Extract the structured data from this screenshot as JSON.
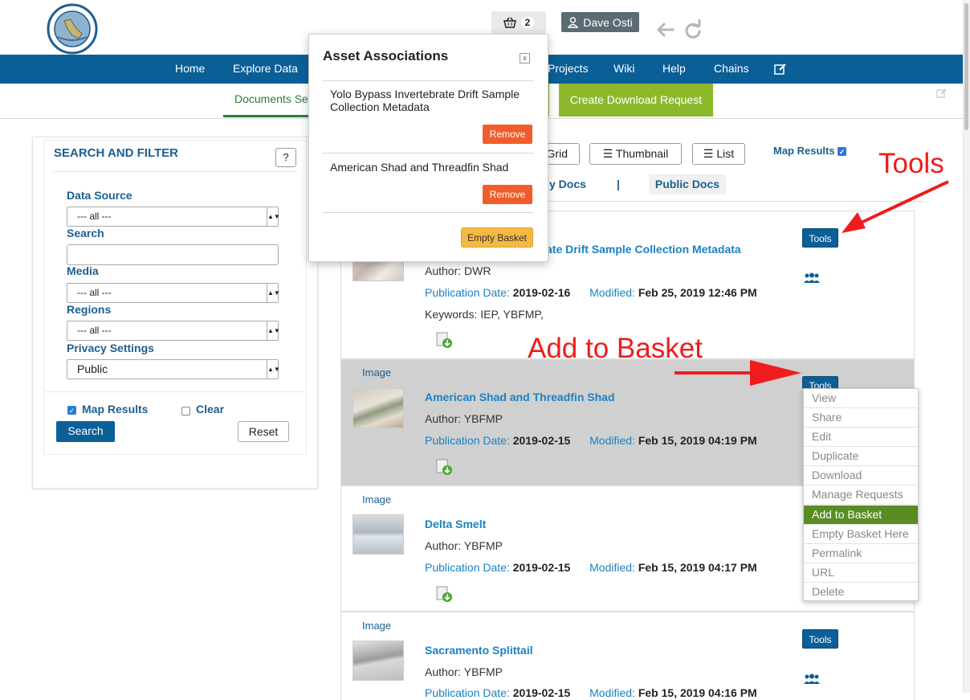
{
  "header": {
    "seal_alt": "Department of Water Resources - State of California",
    "basket_count": "2",
    "user_name": "Dave Osti"
  },
  "nav": {
    "items": [
      "Home",
      "Explore Data",
      "Projects",
      "Wiki",
      "Help",
      "Chains"
    ]
  },
  "subnav": {
    "documents_tab": "Documents Search",
    "create_download": "Create Download Request"
  },
  "sidebar": {
    "title": "SEARCH AND FILTER",
    "help": "?",
    "data_source_label": "Data Source",
    "data_source_value": "--- all ---",
    "search_label": "Search",
    "search_value": "",
    "media_label": "Media",
    "media_value": "--- all ---",
    "regions_label": "Regions",
    "regions_value": "--- all ---",
    "privacy_label": "Privacy Settings",
    "privacy_value": "Public",
    "map_results": "Map Results",
    "clear": "Clear",
    "search_button": "Search",
    "reset_button": "Reset"
  },
  "views": {
    "grid": "Grid",
    "thumbnail": "Thumbnail",
    "list": "List",
    "map_results": "Map Results",
    "my_docs": "y Docs",
    "separator": "|",
    "public_docs": "Public Docs"
  },
  "results": [
    {
      "type": "",
      "title": "ate Drift Sample Collection Metadata",
      "author": "Author: DWR",
      "pub_label": "Publication Date:",
      "pub_date": "2019-02-16",
      "mod_label": "Modified:",
      "mod_date": "Feb 25, 2019 12:46 PM",
      "keywords": "Keywords: IEP, YBFMP,",
      "tools": "Tools"
    },
    {
      "type": "Image",
      "title": "American Shad and Threadfin Shad",
      "author": "Author: YBFMP",
      "pub_label": "Publication Date:",
      "pub_date": "2019-02-15",
      "mod_label": "Modified:",
      "mod_date": "Feb 15, 2019 04:19 PM",
      "tools": "Tools"
    },
    {
      "type": "Image",
      "title": "Delta Smelt",
      "author": "Author: YBFMP",
      "pub_label": "Publication Date:",
      "pub_date": "2019-02-15",
      "mod_label": "Modified:",
      "mod_date": "Feb 15, 2019 04:17 PM"
    },
    {
      "type": "Image",
      "title": "Sacramento Splittail",
      "author": "Author: YBFMP",
      "pub_label": "Publication Date:",
      "pub_date": "2019-02-15",
      "mod_label": "Modified:",
      "mod_date": "Feb 15, 2019 04:16 PM",
      "tools": "Tools"
    }
  ],
  "tools_menu": [
    "View",
    "Share",
    "Edit",
    "Duplicate",
    "Download",
    "Manage Requests",
    "Add to Basket",
    "Empty Basket Here",
    "Permalink",
    "URL",
    "Delete"
  ],
  "popover": {
    "title": "Asset Associations",
    "close": "x",
    "items": [
      {
        "text": "Yolo Bypass Invertebrate Drift Sample Collection Metadata",
        "remove": "Remove"
      },
      {
        "text": "American Shad and Threadfin Shad",
        "remove": "Remove"
      }
    ],
    "empty_basket": "Empty Basket"
  },
  "annotations": {
    "tools": "Tools",
    "add_to_basket": "Add to Basket"
  },
  "colors": {
    "nav_blue": "#0b5f97",
    "accent_green": "#8cb92c",
    "remove_orange": "#f25c2a",
    "annotation_red": "#ee1c1c"
  }
}
